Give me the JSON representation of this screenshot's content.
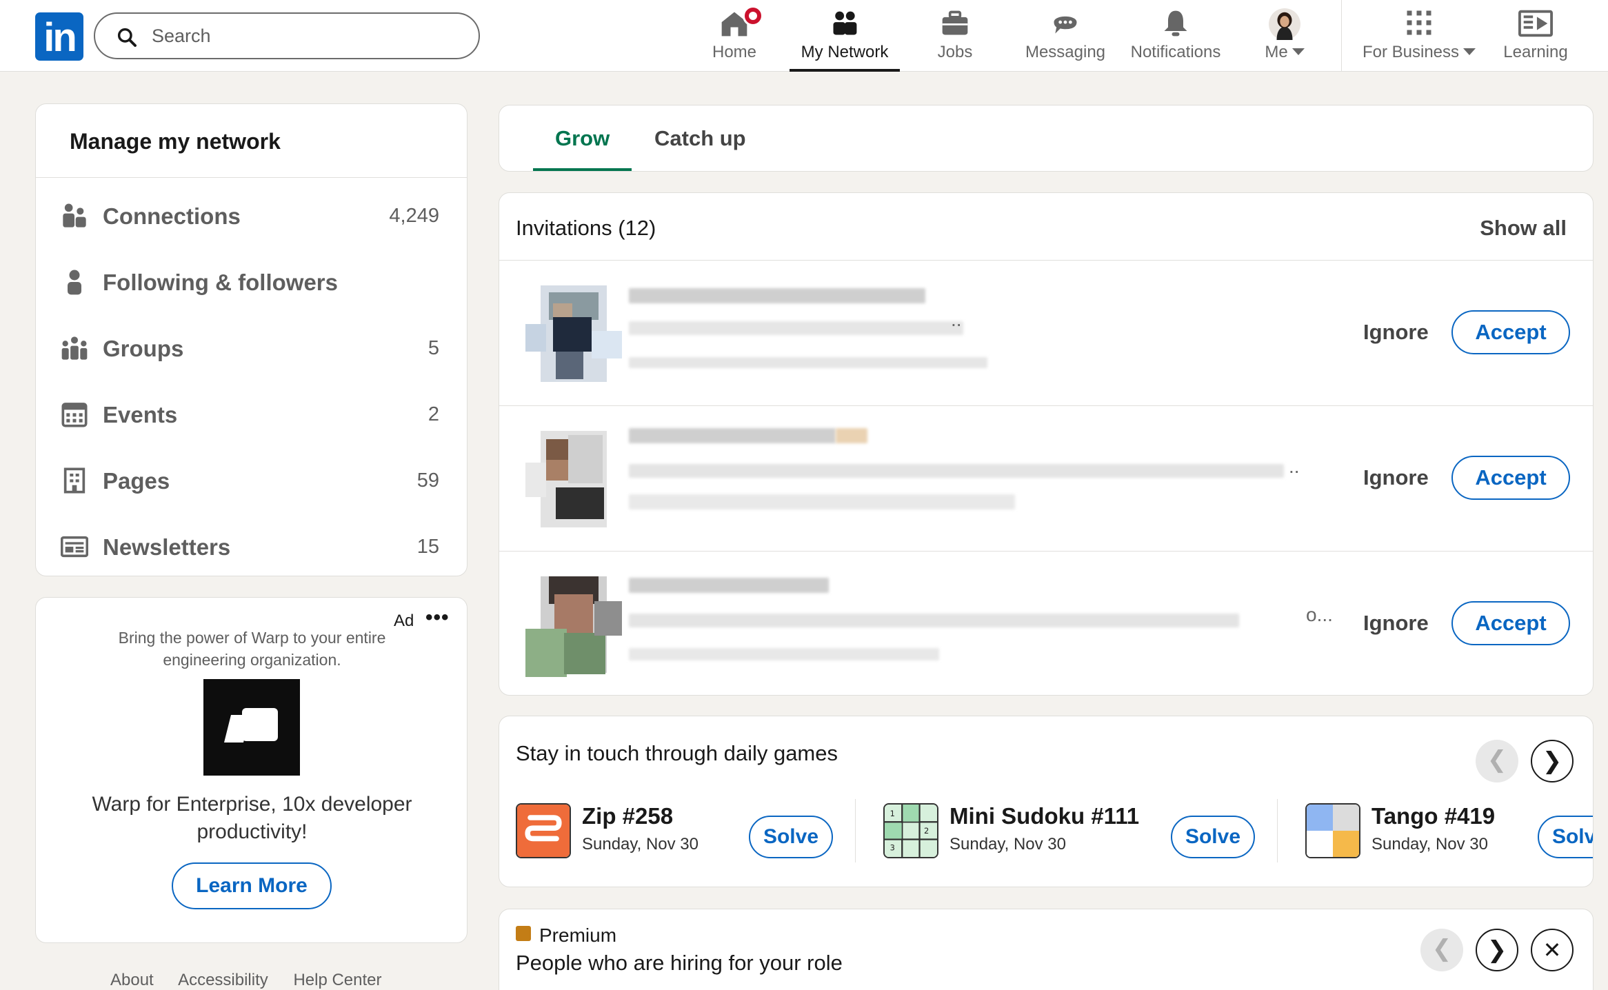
{
  "nav": {
    "search_placeholder": "Search",
    "items": [
      {
        "label": "Home"
      },
      {
        "label": "My Network"
      },
      {
        "label": "Jobs"
      },
      {
        "label": "Messaging"
      },
      {
        "label": "Notifications"
      },
      {
        "label": "Me"
      },
      {
        "label": "For Business"
      },
      {
        "label": "Learning"
      }
    ]
  },
  "manage": {
    "title": "Manage my network",
    "items": [
      {
        "label": "Connections",
        "count": "4,249",
        "icon": "connections-icon"
      },
      {
        "label": "Following & followers",
        "count": "",
        "icon": "person-icon"
      },
      {
        "label": "Groups",
        "count": "5",
        "icon": "groups-icon"
      },
      {
        "label": "Events",
        "count": "2",
        "icon": "calendar-icon"
      },
      {
        "label": "Pages",
        "count": "59",
        "icon": "building-icon"
      },
      {
        "label": "Newsletters",
        "count": "15",
        "icon": "newsletter-icon"
      }
    ]
  },
  "ad": {
    "label": "Ad",
    "more": "•••",
    "text": "Bring the power of Warp to your entire engineering organization.",
    "headline": "Warp for Enterprise, 10x developer productivity!",
    "cta": "Learn More"
  },
  "footer": {
    "links": [
      "About",
      "Accessibility",
      "Help Center"
    ]
  },
  "tabs": {
    "grow": "Grow",
    "catchup": "Catch up"
  },
  "invitations": {
    "title": "Invitations (12)",
    "show_all": "Show all",
    "ignore_label": "Ignore",
    "accept_label": "Accept",
    "ellipsis": [
      "..",
      "..",
      "o..."
    ]
  },
  "games": {
    "title": "Stay in touch through daily games",
    "prev": "❮",
    "next": "❯",
    "solve_label": "Solve",
    "list": [
      {
        "name": "Zip #258",
        "date": "Sunday, Nov 30"
      },
      {
        "name": "Mini Sudoku #111",
        "date": "Sunday, Nov 30"
      },
      {
        "name": "Tango #419",
        "date": "Sunday, Nov 30"
      }
    ]
  },
  "premium": {
    "label": "Premium",
    "title": "People who are hiring for your role",
    "close": "✕"
  },
  "colors": {
    "brand": "#0a66c2",
    "grow": "#01754f",
    "badge": "#cb112d"
  }
}
